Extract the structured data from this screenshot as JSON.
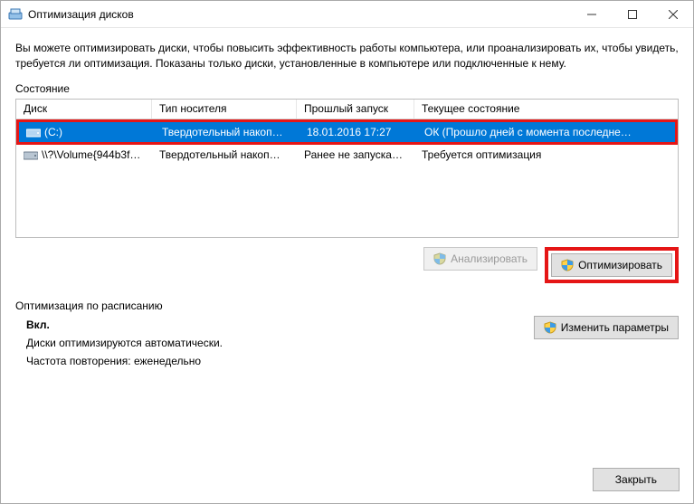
{
  "window": {
    "title": "Оптимизация дисков"
  },
  "intro": "Вы можете оптимизировать диски, чтобы повысить эффективность работы  компьютера, или проанализировать их, чтобы увидеть, требуется ли оптимизация. Показаны только диски, установленные в компьютере или подключенные к нему.",
  "status_label": "Состояние",
  "columns": {
    "disk": "Диск",
    "media": "Тип носителя",
    "last": "Прошлый запуск",
    "state": "Текущее состояние"
  },
  "drives": [
    {
      "name": "(C:)",
      "media": "Твердотельный накоп…",
      "last": "18.01.2016 17:27",
      "state": "ОК (Прошло дней с момента последне…",
      "selected": true
    },
    {
      "name": "\\\\?\\Volume{944b3f…",
      "media": "Твердотельный накоп…",
      "last": "Ранее не запуска…",
      "state": "Требуется оптимизация",
      "selected": false
    }
  ],
  "buttons": {
    "analyze": "Анализировать",
    "optimize": "Оптимизировать",
    "change": "Изменить параметры",
    "close": "Закрыть"
  },
  "schedule": {
    "label": "Оптимизация по расписанию",
    "on": "Вкл.",
    "line1": "Диски оптимизируются автоматически.",
    "line2": "Частота повторения: еженедельно"
  }
}
